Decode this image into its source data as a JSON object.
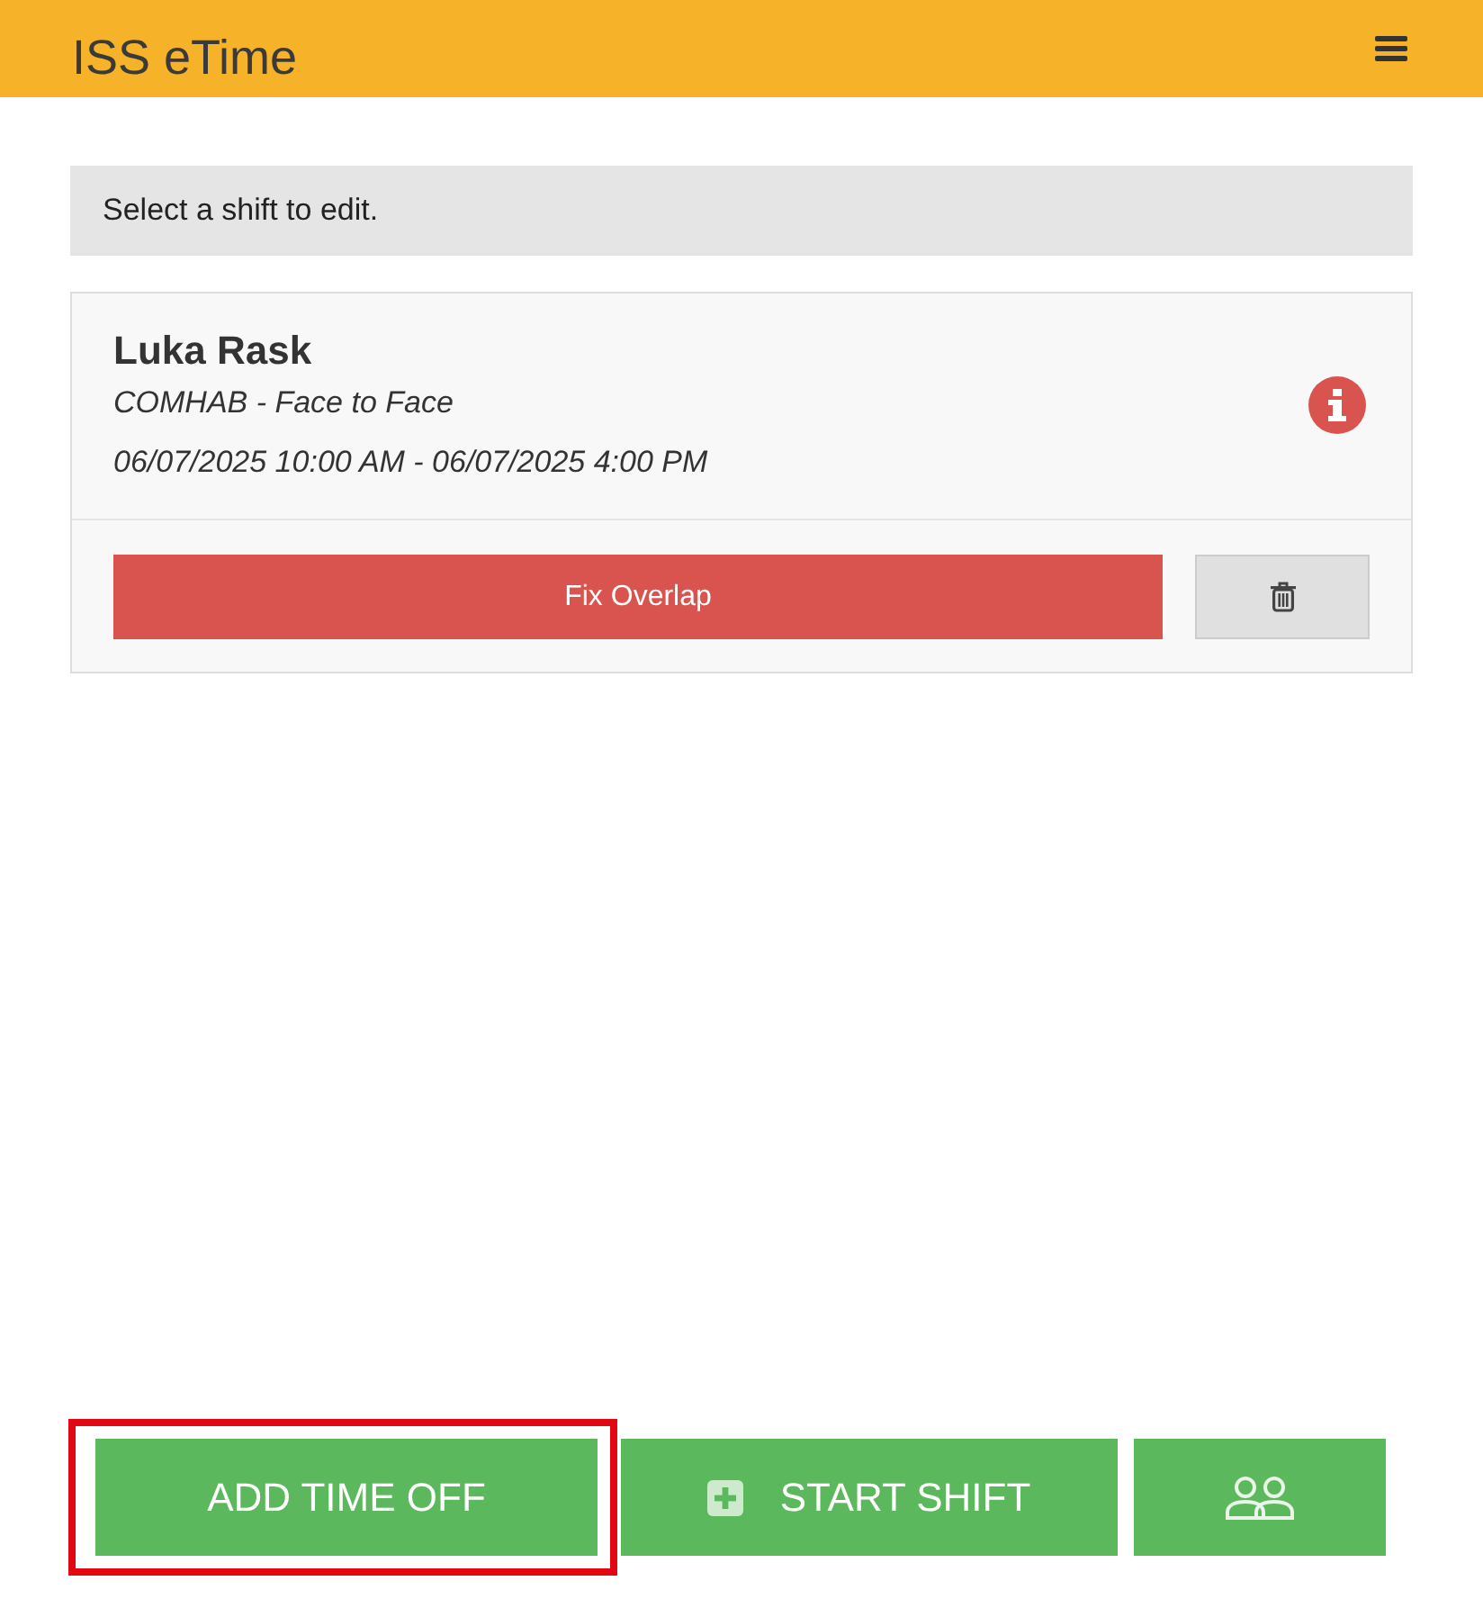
{
  "header": {
    "title": "ISS eTime"
  },
  "notice": "Select a shift to edit.",
  "shifts": [
    {
      "name": "Luka Rask",
      "service": "COMHAB - Face to Face",
      "time_range": "06/07/2025 10:00 AM - 06/07/2025 4:00 PM",
      "warning": true,
      "action": "Fix Overlap"
    }
  ],
  "bottom_buttons": [
    {
      "kind": "text",
      "label": "ADD TIME OFF",
      "highlighted": true
    },
    {
      "kind": "icon_text",
      "label": "START SHIFT",
      "highlighted": false
    },
    {
      "kind": "icon",
      "highlighted": false
    }
  ]
}
